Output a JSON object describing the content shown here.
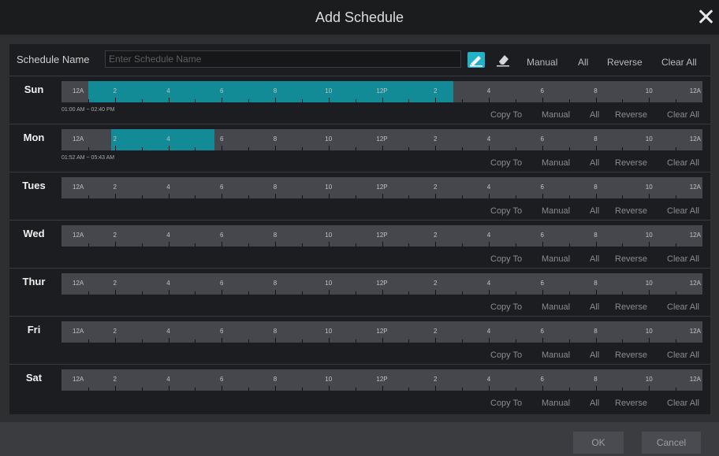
{
  "window": {
    "title": "Add Schedule"
  },
  "toolbar": {
    "name_label": "Schedule Name",
    "name_placeholder": "Enter Schedule Name",
    "name_value": "",
    "draw_tool_icon": "pen-icon",
    "erase_tool_icon": "eraser-icon",
    "manual": "Manual",
    "all": "All",
    "reverse": "Reverse",
    "clear_all": "Clear All"
  },
  "hour_labels": [
    "12A",
    "2",
    "4",
    "6",
    "8",
    "10",
    "12P",
    "2",
    "4",
    "6",
    "8",
    "10",
    "12A"
  ],
  "row_actions": {
    "copy_to": "Copy To",
    "manual": "Manual",
    "all": "All",
    "reverse": "Reverse",
    "clear_all": "Clear All"
  },
  "accent_color": "#138b97",
  "days": [
    {
      "name": "Sun",
      "start_hour": 1.0,
      "end_hour": 14.667,
      "range_text": "01:00 AM ~ 02:40 PM"
    },
    {
      "name": "Mon",
      "start_hour": 1.867,
      "end_hour": 5.717,
      "range_text": "01:52 AM ~ 05:43 AM"
    },
    {
      "name": "Tues",
      "start_hour": null,
      "end_hour": null,
      "range_text": ""
    },
    {
      "name": "Wed",
      "start_hour": null,
      "end_hour": null,
      "range_text": ""
    },
    {
      "name": "Thur",
      "start_hour": null,
      "end_hour": null,
      "range_text": ""
    },
    {
      "name": "Fri",
      "start_hour": null,
      "end_hour": null,
      "range_text": ""
    },
    {
      "name": "Sat",
      "start_hour": null,
      "end_hour": null,
      "range_text": ""
    }
  ],
  "footer": {
    "ok": "OK",
    "cancel": "Cancel"
  }
}
